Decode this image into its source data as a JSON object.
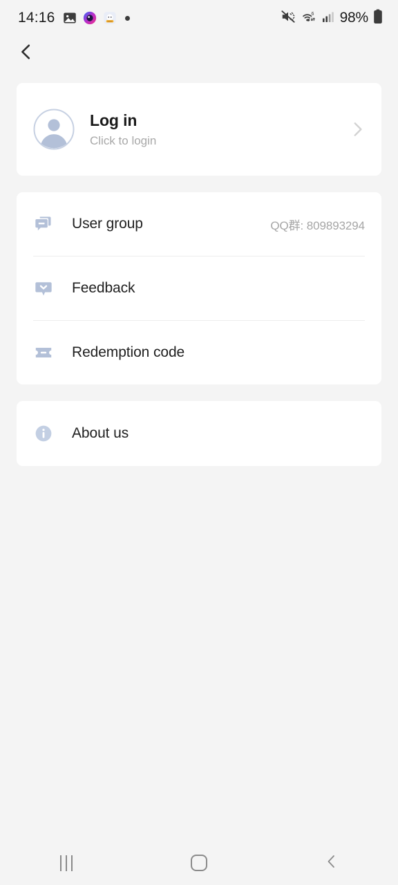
{
  "status_bar": {
    "time": "14:16",
    "battery_percent": "98%",
    "left_icons": [
      "photos-icon",
      "camera-filter-icon",
      "app-badge-icon",
      "dot-indicator-icon"
    ],
    "right_icons": [
      "volume-mute-icon",
      "wifi-6-icon",
      "cellular-signal-icon",
      "battery-icon"
    ]
  },
  "top_bar": {
    "back_icon": "chevron-left-icon"
  },
  "login_card": {
    "avatar_icon": "avatar-placeholder-icon",
    "title": "Log in",
    "subtitle": "Click to login",
    "chevron_icon": "chevron-right-icon"
  },
  "menu_card": {
    "items": [
      {
        "icon": "forum-icon",
        "label": "User group",
        "value": "QQ群: 809893294"
      },
      {
        "icon": "feedback-icon",
        "label": "Feedback",
        "value": ""
      },
      {
        "icon": "ticket-icon",
        "label": "Redemption code",
        "value": ""
      }
    ]
  },
  "about_card": {
    "items": [
      {
        "icon": "info-circle-icon",
        "label": "About us",
        "value": ""
      }
    ]
  },
  "nav_bar": {
    "recents_label": "recents-icon",
    "home_label": "home-icon",
    "back_label": "back-icon"
  },
  "colors": {
    "background": "#f4f4f4",
    "card": "#ffffff",
    "icon_accent": "#b3c0d8",
    "primary_text": "#1f1f1f",
    "secondary_text": "#a6a6a6",
    "divider": "#ededed"
  }
}
